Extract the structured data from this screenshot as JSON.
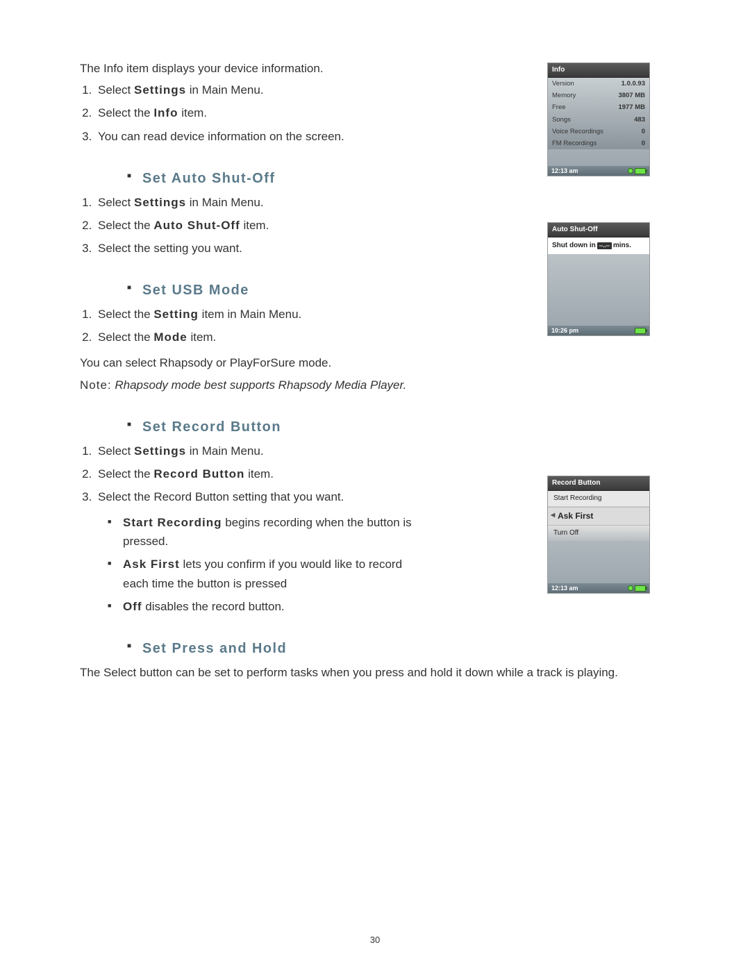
{
  "page_number": "30",
  "sections": {
    "info": {
      "intro": "The Info item displays your device information.",
      "steps": [
        "Select Settings in Main Menu.",
        "Select the Info item.",
        "You can read device information on the screen."
      ]
    },
    "auto_shut_off": {
      "heading": "Set Auto Shut-Off",
      "steps": [
        "Select Settings in Main Menu.",
        "Select the Auto Shut-Off item.",
        "Select the setting you want."
      ]
    },
    "usb_mode": {
      "heading": "Set USB Mode",
      "steps": [
        "Select the Setting item in Main Menu.",
        "Select the Mode item."
      ],
      "line": "You can select Rhapsody or PlayForSure mode.",
      "note_label": "Note:",
      "note_body": "Rhapsody mode best supports Rhapsody Media Player."
    },
    "record_button": {
      "heading": "Set Record Button",
      "steps": [
        "Select Settings in Main Menu.",
        "Select the Record Button item.",
        "Select the Record Button setting that you want."
      ],
      "bullets": [
        {
          "bold": "Start Recording",
          "rest": " begins recording when the button is pressed."
        },
        {
          "bold": "Ask First",
          "rest": " lets you confirm if you would like to record each time the button is pressed"
        },
        {
          "bold": "Off",
          "rest": " disables the record button."
        }
      ]
    },
    "press_hold": {
      "heading": "Set Press and Hold",
      "text": "The Select button can be set to perform tasks when you press and hold it down while a track is playing."
    }
  },
  "device_info": {
    "title": "Info",
    "rows": [
      {
        "label": "Version",
        "value": "1.0.0.93"
      },
      {
        "label": "Memory",
        "value": "3807 MB"
      },
      {
        "label": "Free",
        "value": "1977 MB"
      },
      {
        "label": "Songs",
        "value": "483"
      },
      {
        "label": "Voice Recordings",
        "value": "0"
      },
      {
        "label": "FM Recordings",
        "value": "0"
      }
    ],
    "time": "12:13 am"
  },
  "device_autoshut": {
    "title": "Auto Shut-Off",
    "prefix": "Shut down in",
    "selector": "--..--",
    "suffix": "mins.",
    "time": "10:26 pm"
  },
  "device_record": {
    "title": "Record Button",
    "items": [
      {
        "label": "Start Recording",
        "selected": false
      },
      {
        "label": "Ask First",
        "selected": true
      },
      {
        "label": "Turn Off",
        "selected": false
      }
    ],
    "time": "12:13 am"
  }
}
